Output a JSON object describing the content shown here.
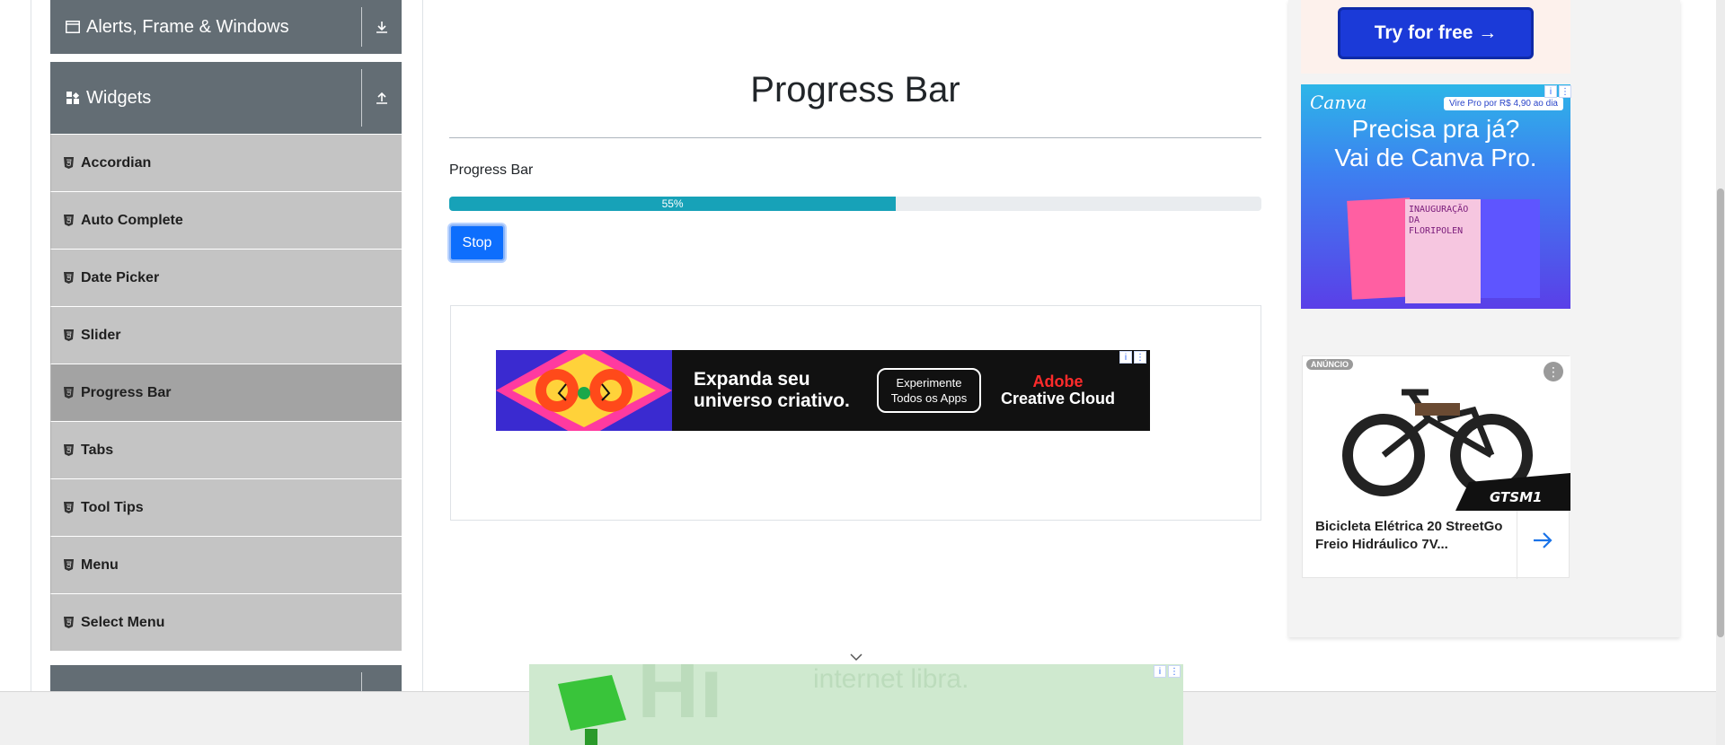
{
  "sidebar": {
    "groups": [
      {
        "label": "Alerts, Frame & Windows",
        "toggle": "download-icon"
      },
      {
        "label": "Widgets",
        "toggle": "upload-icon"
      }
    ],
    "items": [
      {
        "label": "Accordian"
      },
      {
        "label": "Auto Complete"
      },
      {
        "label": "Date Picker"
      },
      {
        "label": "Slider"
      },
      {
        "label": "Progress Bar",
        "active": true
      },
      {
        "label": "Tabs"
      },
      {
        "label": "Tool Tips"
      },
      {
        "label": "Menu"
      },
      {
        "label": "Select Menu"
      }
    ]
  },
  "main": {
    "title": "Progress Bar",
    "progress_label": "Progress Bar",
    "progress": {
      "value_percent": 55,
      "text": "55%"
    },
    "stop_button": "Stop"
  },
  "ads": {
    "adobe": {
      "headline_line1": "Expanda seu",
      "headline_line2": "universo criativo.",
      "cta_line1": "Experimente",
      "cta_line2": "Todos os Apps",
      "brand_line1": "Adobe",
      "brand_line2": "Creative Cloud"
    },
    "try_free": "Try for free →",
    "canva": {
      "logo": "Canva",
      "badge": "Vire Pro por R$ 4,90 ao dia",
      "headline_line1": "Precisa pra já?",
      "headline_line2": "Vai de Canva Pro.",
      "card_text": "INAUGURAÇÃO DA FLORIPOLEN"
    },
    "bike": {
      "tag": "ANÚNCIO",
      "title": "Bicicleta Elétrica 20 StreetGo Freio Hidráulico 7V...",
      "brand_mark": "GTSM1"
    },
    "bottom": {
      "ghost_text": "Hi",
      "ghost_subtext": "internet libra."
    }
  },
  "colors": {
    "sidebar_header": "#636d74",
    "menu_item": "#c4c4c4",
    "menu_item_active": "#a3a3a3",
    "progress_fill": "#17a2b8",
    "primary_button": "#0d6efd"
  }
}
